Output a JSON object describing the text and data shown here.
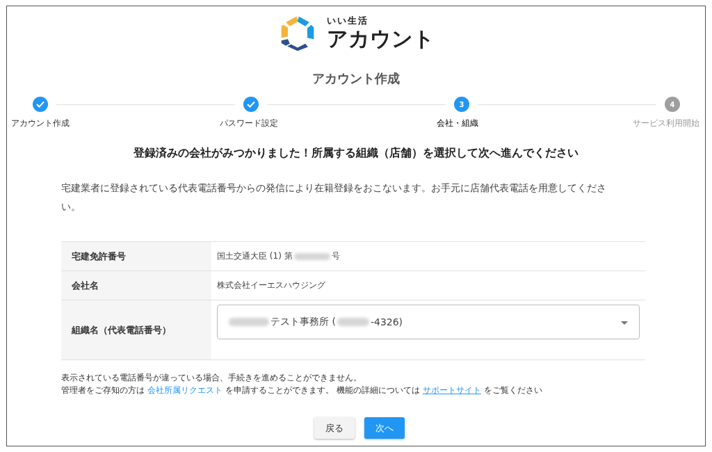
{
  "logo": {
    "tagline": "いい生活",
    "name": "アカウント"
  },
  "page_title": "アカウント作成",
  "steps": [
    {
      "label": "アカウント作成",
      "completed": true,
      "active": false
    },
    {
      "label": "パスワード設定",
      "completed": true,
      "active": false
    },
    {
      "number": "3",
      "label": "会社・組織",
      "completed": false,
      "active": true
    },
    {
      "number": "4",
      "label": "サービス利用開始",
      "completed": false,
      "active": false
    }
  ],
  "heading": "登録済みの会社がみつかりました！所属する組織（店舗）を選択して次へ進んでください",
  "description": "宅建業者に登録されている代表電話番号からの発信により在籍登録をおこないます。お手元に店舗代表電話を用意してください。",
  "table": {
    "rows": [
      {
        "label": "宅建免許番号",
        "kind": "text",
        "segments": [
          {
            "kind": "text",
            "text": "国土交通大臣 (1) 第"
          },
          {
            "kind": "redacted"
          },
          {
            "kind": "text",
            "text": "号"
          }
        ]
      },
      {
        "label": "会社名",
        "kind": "text",
        "segments": [
          {
            "kind": "text",
            "text": "株式会社イーエスハウジング"
          }
        ]
      },
      {
        "label": "組織名（代表電話番号）",
        "kind": "select",
        "segments": [
          {
            "kind": "redacted"
          },
          {
            "kind": "text",
            "text": "テスト事務所 ("
          },
          {
            "kind": "redacted"
          },
          {
            "kind": "text",
            "text": "-4326)"
          }
        ]
      }
    ]
  },
  "notes": [
    [
      {
        "kind": "text",
        "text": "表示されている電話番号が違っている場合、手続きを進めることができません。"
      }
    ],
    [
      {
        "kind": "text",
        "text": "管理者をご存知の方は"
      },
      {
        "kind": "link",
        "text": "会社所属リクエスト",
        "underline": false
      },
      {
        "kind": "text",
        "text": "を申請することができます。 機能の詳細については"
      },
      {
        "kind": "link",
        "text": "サポートサイト",
        "underline": true
      },
      {
        "kind": "text",
        "text": "をご覧ください"
      }
    ]
  ],
  "buttons": [
    {
      "label": "戻る",
      "primary": false
    },
    {
      "label": "次へ",
      "primary": true
    }
  ]
}
